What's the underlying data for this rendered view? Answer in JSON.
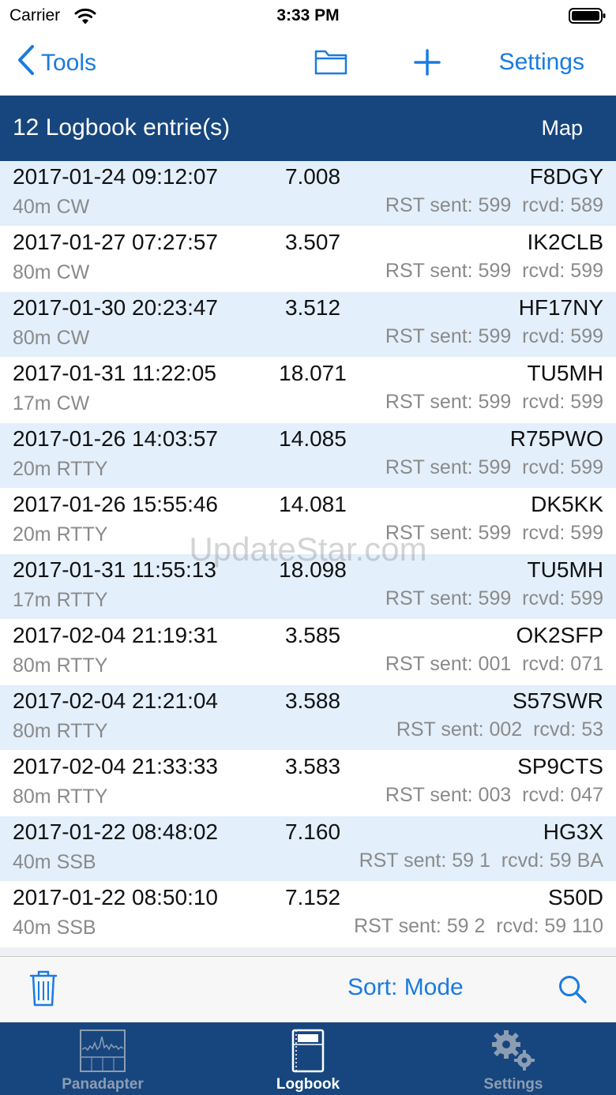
{
  "status_bar": {
    "carrier": "Carrier",
    "time": "3:33 PM"
  },
  "nav": {
    "back_label": "Tools",
    "settings_label": "Settings"
  },
  "header": {
    "title": "12 Logbook entrie(s)",
    "map_label": "Map"
  },
  "entries": [
    {
      "datetime": "2017-01-24 09:12:07",
      "freq": "7.008",
      "call": "F8DGY",
      "band": "40m CW",
      "rst": "RST sent: 599  rcvd: 589"
    },
    {
      "datetime": "2017-01-27 07:27:57",
      "freq": "3.507",
      "call": "IK2CLB",
      "band": "80m CW",
      "rst": "RST sent: 599  rcvd: 599"
    },
    {
      "datetime": "2017-01-30 20:23:47",
      "freq": "3.512",
      "call": "HF17NY",
      "band": "80m CW",
      "rst": "RST sent: 599  rcvd: 599"
    },
    {
      "datetime": "2017-01-31 11:22:05",
      "freq": "18.071",
      "call": "TU5MH",
      "band": "17m CW",
      "rst": "RST sent: 599  rcvd: 599"
    },
    {
      "datetime": "2017-01-26 14:03:57",
      "freq": "14.085",
      "call": "R75PWO",
      "band": "20m RTTY",
      "rst": "RST sent: 599  rcvd: 599"
    },
    {
      "datetime": "2017-01-26 15:55:46",
      "freq": "14.081",
      "call": "DK5KK",
      "band": "20m RTTY",
      "rst": "RST sent: 599  rcvd: 599"
    },
    {
      "datetime": "2017-01-31 11:55:13",
      "freq": "18.098",
      "call": "TU5MH",
      "band": "17m RTTY",
      "rst": "RST sent: 599  rcvd: 599"
    },
    {
      "datetime": "2017-02-04 21:19:31",
      "freq": "3.585",
      "call": "OK2SFP",
      "band": "80m RTTY",
      "rst": "RST sent: 001  rcvd: 071"
    },
    {
      "datetime": "2017-02-04 21:21:04",
      "freq": "3.588",
      "call": "S57SWR",
      "band": "80m RTTY",
      "rst": "RST sent: 002  rcvd: 53"
    },
    {
      "datetime": "2017-02-04 21:33:33",
      "freq": "3.583",
      "call": "SP9CTS",
      "band": "80m RTTY",
      "rst": "RST sent: 003  rcvd: 047"
    },
    {
      "datetime": "2017-01-22 08:48:02",
      "freq": "7.160",
      "call": "HG3X",
      "band": "40m SSB",
      "rst": "RST sent: 59 1  rcvd: 59 BA"
    },
    {
      "datetime": "2017-01-22 08:50:10",
      "freq": "7.152",
      "call": "S50D",
      "band": "40m SSB",
      "rst": "RST sent: 59 2  rcvd: 59 110"
    }
  ],
  "toolbar": {
    "sort_label": "Sort: Mode"
  },
  "tabs": [
    {
      "label": "Panadapter",
      "icon": "panadapter-icon"
    },
    {
      "label": "Logbook",
      "icon": "logbook-icon"
    },
    {
      "label": "Settings",
      "icon": "gear-icon"
    }
  ],
  "watermark": "UpdateStar.com",
  "colors": {
    "accent": "#1a7be0",
    "header_bg": "#17467e",
    "row_alt": "#e3effb",
    "secondary_text": "#8a8a8a"
  }
}
